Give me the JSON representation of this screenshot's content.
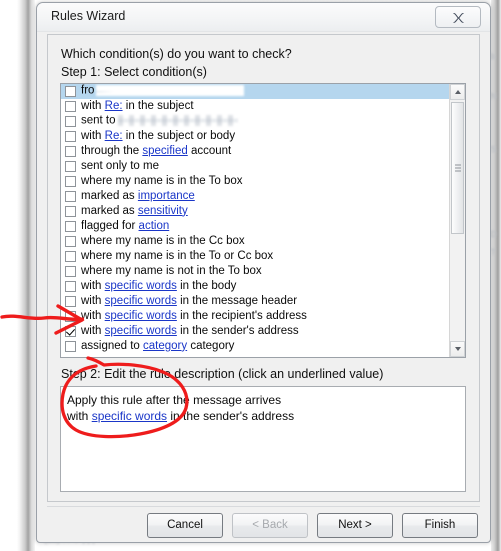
{
  "window": {
    "title": "Rules Wizard",
    "close_icon": "close-x-icon"
  },
  "content": {
    "prompt": "Which condition(s) do you want to check?",
    "step1_label": "Step 1: Select condition(s)",
    "step2_label": "Step 2: Edit the rule description (click an underlined value)"
  },
  "conditions": [
    {
      "pre": "fro",
      "link": "",
      "post": "",
      "checked": false,
      "selected": true,
      "redacted": "r1"
    },
    {
      "pre": "with ",
      "link": "Re:",
      "post": " in the subject",
      "checked": false,
      "selected": false,
      "redacted": ""
    },
    {
      "pre": "sent to",
      "link": "",
      "post": "",
      "checked": false,
      "selected": false,
      "redacted": "r2"
    },
    {
      "pre": "with ",
      "link": "Re:",
      "post": " in the subject or body",
      "checked": false,
      "selected": false,
      "redacted": ""
    },
    {
      "pre": "through the ",
      "link": "specified",
      "post": " account",
      "checked": false,
      "selected": false,
      "redacted": ""
    },
    {
      "pre": "sent only to me",
      "link": "",
      "post": "",
      "checked": false,
      "selected": false,
      "redacted": ""
    },
    {
      "pre": "where my name is in the To box",
      "link": "",
      "post": "",
      "checked": false,
      "selected": false,
      "redacted": ""
    },
    {
      "pre": "marked as ",
      "link": "importance",
      "post": "",
      "checked": false,
      "selected": false,
      "redacted": ""
    },
    {
      "pre": "marked as ",
      "link": "sensitivity",
      "post": "",
      "checked": false,
      "selected": false,
      "redacted": ""
    },
    {
      "pre": "flagged for ",
      "link": "action",
      "post": "",
      "checked": false,
      "selected": false,
      "redacted": ""
    },
    {
      "pre": "where my name is in the Cc box",
      "link": "",
      "post": "",
      "checked": false,
      "selected": false,
      "redacted": ""
    },
    {
      "pre": "where my name is in the To or Cc box",
      "link": "",
      "post": "",
      "checked": false,
      "selected": false,
      "redacted": ""
    },
    {
      "pre": "where my name is not in the To box",
      "link": "",
      "post": "",
      "checked": false,
      "selected": false,
      "redacted": ""
    },
    {
      "pre": "with ",
      "link": "specific words",
      "post": " in the body",
      "checked": false,
      "selected": false,
      "redacted": ""
    },
    {
      "pre": "with ",
      "link": "specific words",
      "post": " in the message header",
      "checked": false,
      "selected": false,
      "redacted": ""
    },
    {
      "pre": "with ",
      "link": "specific words",
      "post": " in the recipient's address",
      "checked": false,
      "selected": false,
      "redacted": ""
    },
    {
      "pre": "with ",
      "link": "specific words",
      "post": " in the sender's address",
      "checked": true,
      "selected": false,
      "redacted": ""
    },
    {
      "pre": "assigned to ",
      "link": "category",
      "post": " category",
      "checked": false,
      "selected": false,
      "redacted": ""
    }
  ],
  "description": {
    "line1": "Apply this rule after the message arrives",
    "line2_pre": "with ",
    "line2_link": "specific words",
    "line2_post": " in the sender's address"
  },
  "buttons": {
    "cancel": "Cancel",
    "back": "< Back",
    "next": "Next >",
    "finish": "Finish"
  },
  "colors": {
    "selection": "#b5d6ee",
    "link": "#1a36c8",
    "annotation": "#ee1c1c",
    "dialog_face": "#f0f0f0"
  },
  "annotations": {
    "arrow_target": "checked-condition-row",
    "circle_target": "rule-description-text"
  }
}
